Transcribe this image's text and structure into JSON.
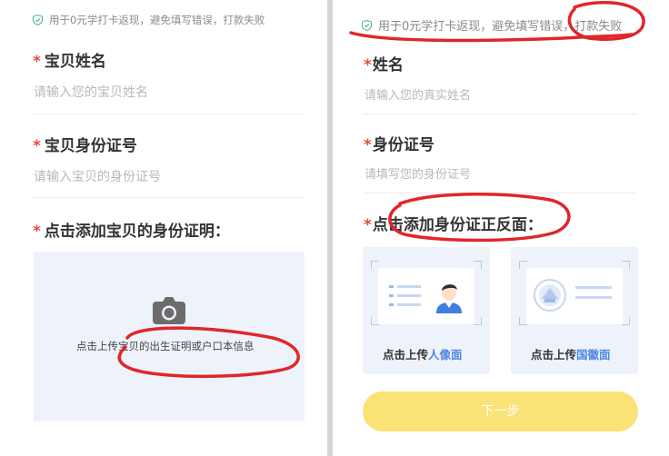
{
  "left": {
    "notice": "用于0元学打卡返现，避免填写错误，打款失败",
    "name_label": "宝贝姓名",
    "name_placeholder": "请输入您的宝贝姓名",
    "id_label": "宝贝身份证号",
    "id_placeholder": "请输入宝贝的身份证号",
    "proof_label": "点击添加宝贝的身份证明：",
    "upload_text": "点击上传宝贝的出生证明或户口本信息",
    "upload_icon": "camera-icon"
  },
  "right": {
    "notice": "用于0元学打卡返现，避免填写错误，打款失败",
    "name_label": "姓名",
    "name_placeholder": "请输入您的真实姓名",
    "id_label": "身份证号",
    "id_placeholder": "请填写您的身份证号",
    "proof_label": "点击添加身份证正反面：",
    "front_caption_prefix": "点击上传",
    "front_caption_highlight": "人像面",
    "back_caption_prefix": "点击上传",
    "back_caption_highlight": "国徽面",
    "next_button": "下一步"
  },
  "required_mark": "*",
  "colors": {
    "required": "#e84a3c",
    "highlight_text": "#4b86e8",
    "button": "#fbe277",
    "upload_bg": "#eef2fb",
    "scribble": "#e0262b",
    "notice_icon": "#4cb38a"
  }
}
